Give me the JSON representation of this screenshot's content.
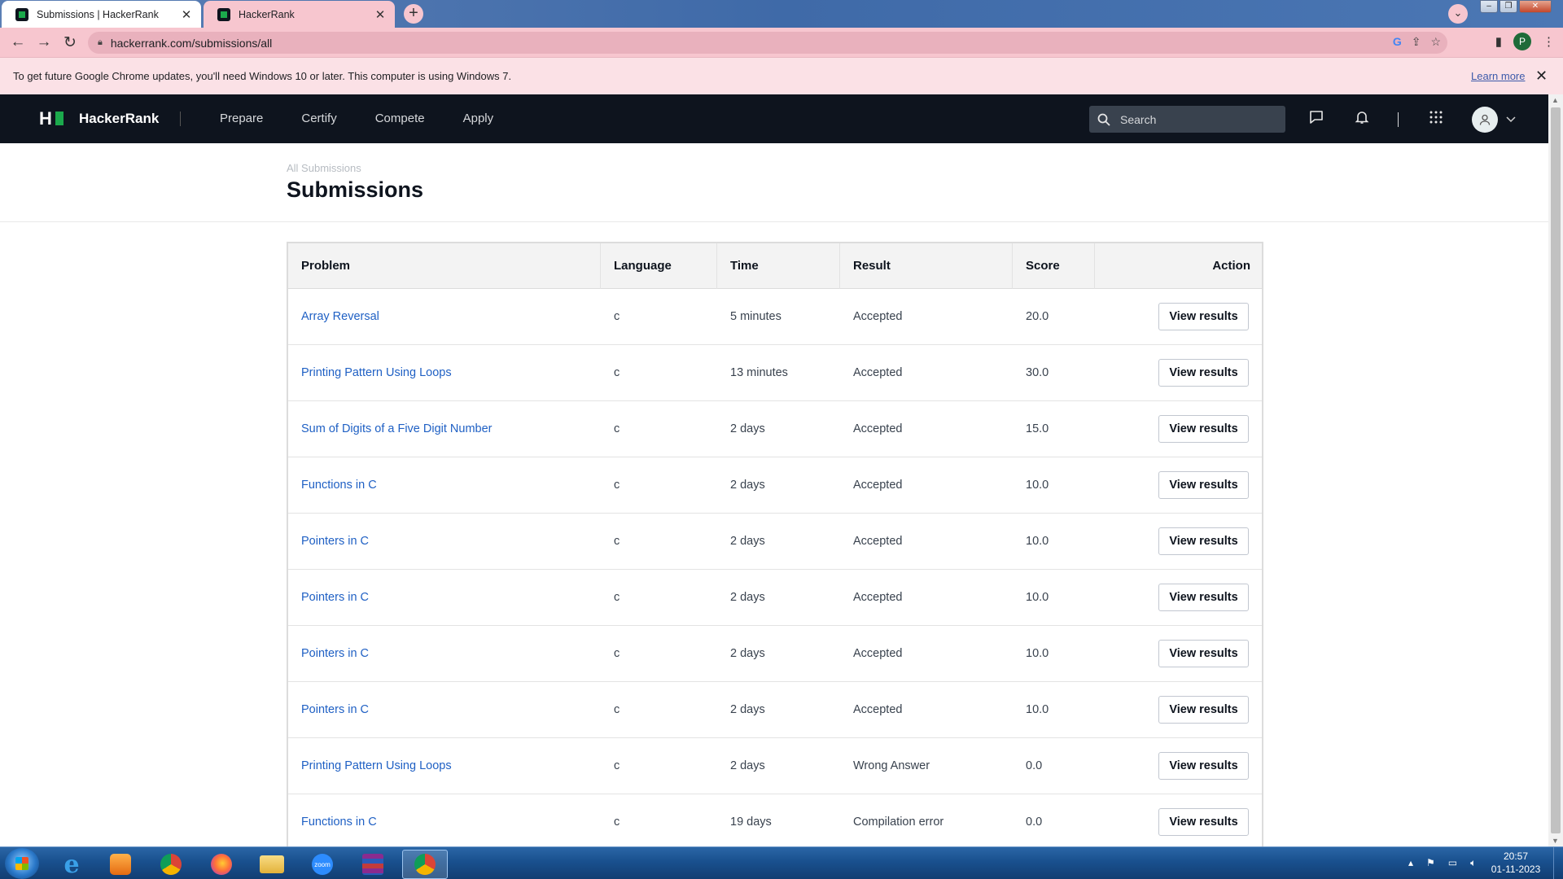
{
  "browser": {
    "tabs": [
      {
        "title": "Submissions | HackerRank",
        "close": "✕"
      },
      {
        "title": "HackerRank",
        "close": "✕"
      }
    ],
    "new_tab": "+",
    "tab_search": "⌄",
    "url": "hackerrank.com/submissions/all",
    "profile_initial": "P"
  },
  "infobar": {
    "message": "To get future Google Chrome updates, you'll need Windows 10 or later. This computer is using Windows 7.",
    "learn_more": "Learn more",
    "close": "✕"
  },
  "nav": {
    "brand": "HackerRank",
    "logo_letter": "H",
    "menu": [
      "Prepare",
      "Certify",
      "Compete",
      "Apply"
    ],
    "search_placeholder": "Search"
  },
  "page": {
    "breadcrumb": "All Submissions",
    "title": "Submissions"
  },
  "table": {
    "headers": [
      "Problem",
      "Language",
      "Time",
      "Result",
      "Score",
      "Action"
    ],
    "action_label": "View results",
    "rows": [
      {
        "problem": "Array Reversal",
        "language": "c",
        "time": "5 minutes",
        "result": "Accepted",
        "score": "20.0"
      },
      {
        "problem": "Printing Pattern Using Loops",
        "language": "c",
        "time": "13 minutes",
        "result": "Accepted",
        "score": "30.0"
      },
      {
        "problem": "Sum of Digits of a Five Digit Number",
        "language": "c",
        "time": "2 days",
        "result": "Accepted",
        "score": "15.0"
      },
      {
        "problem": "Functions in C",
        "language": "c",
        "time": "2 days",
        "result": "Accepted",
        "score": "10.0"
      },
      {
        "problem": "Pointers in C",
        "language": "c",
        "time": "2 days",
        "result": "Accepted",
        "score": "10.0"
      },
      {
        "problem": "Pointers in C",
        "language": "c",
        "time": "2 days",
        "result": "Accepted",
        "score": "10.0"
      },
      {
        "problem": "Pointers in C",
        "language": "c",
        "time": "2 days",
        "result": "Accepted",
        "score": "10.0"
      },
      {
        "problem": "Pointers in C",
        "language": "c",
        "time": "2 days",
        "result": "Accepted",
        "score": "10.0"
      },
      {
        "problem": "Printing Pattern Using Loops",
        "language": "c",
        "time": "2 days",
        "result": "Wrong Answer",
        "score": "0.0"
      },
      {
        "problem": "Functions in C",
        "language": "c",
        "time": "19 days",
        "result": "Compilation error",
        "score": "0.0"
      }
    ]
  },
  "taskbar": {
    "apps": [
      "internet-explorer",
      "media-player",
      "chrome",
      "firefox",
      "file-explorer",
      "zoom",
      "winrar",
      "chrome-profile"
    ],
    "zoom_label": "zoom",
    "time": "20:57",
    "date": "01-11-2023"
  },
  "colors": {
    "nav_bg": "#0e141e",
    "brand_green": "#1ba94c",
    "link_blue": "#1f60c4",
    "tab_pink": "#f7c6cf"
  }
}
